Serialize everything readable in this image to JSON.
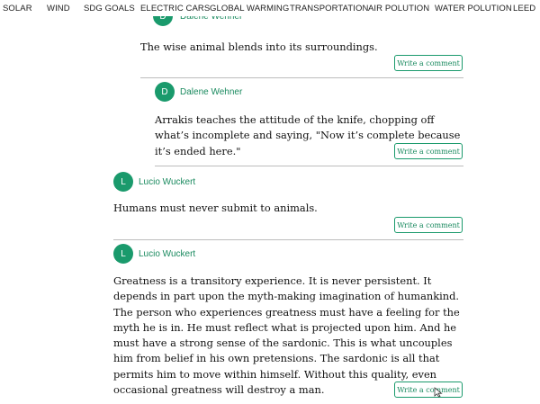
{
  "nav": {
    "items": [
      "SOLAR",
      "WIND",
      "SDG GOALS",
      "ELECTRIC CARS",
      "GLOBAL WARMING",
      "TRANSPORTATION",
      "AIR POLUTION",
      "WATER POLUTION",
      "LEED"
    ]
  },
  "comments": [
    {
      "avatar": "D",
      "author": "Dalene Wehner",
      "text": "The wise animal blends into its surroundings.",
      "button": "Write a comment"
    },
    {
      "avatar": "D",
      "author": "Dalene Wehner",
      "text": "Arrakis teaches the attitude of the knife, chopping off what’s incomplete and saying, \"Now it’s complete because it’s ended here.\"",
      "button": "Write a comment"
    },
    {
      "avatar": "L",
      "author": "Lucio Wuckert",
      "text": "Humans must never submit to animals.",
      "button": "Write a comment"
    },
    {
      "avatar": "L",
      "author": "Lucio Wuckert",
      "text": "Greatness is a transitory experience. It is never persistent. It depends in part upon the myth-making imagination of humankind. The person who experiences greatness must have a feeling for the myth he is in. He must reflect what is projected upon him. And he must have a strong sense of the sardonic. This is what uncouples him from belief in his own pretensions. The sardonic is all that permits him to move within himself. Without this quality, even occasional greatness will destroy a man.",
      "button": "Write a comment"
    }
  ]
}
